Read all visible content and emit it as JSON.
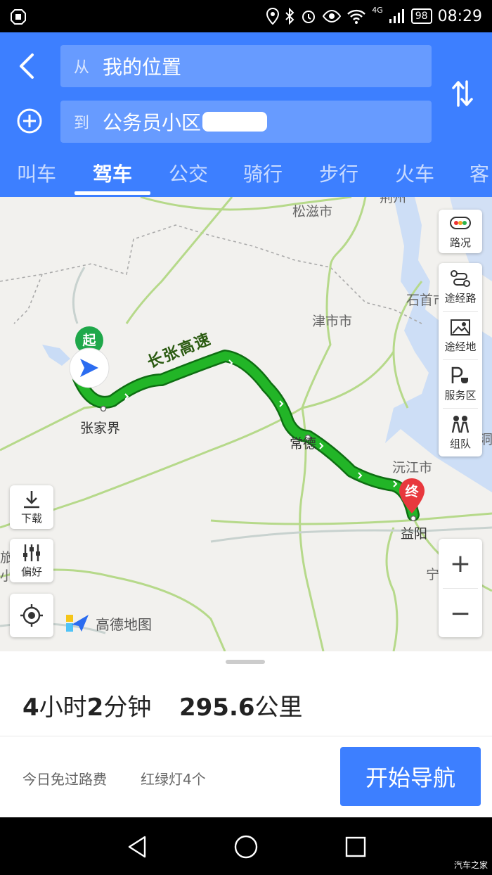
{
  "status_bar": {
    "network": "4G",
    "battery": "98",
    "time": "08:29"
  },
  "route_form": {
    "from_prefix": "从",
    "from_value": "我的位置",
    "to_prefix": "到",
    "to_value": "公务员小区"
  },
  "tabs": [
    {
      "label": "叫车"
    },
    {
      "label": "驾车"
    },
    {
      "label": "公交"
    },
    {
      "label": "骑行"
    },
    {
      "label": "步行"
    },
    {
      "label": "火车"
    },
    {
      "label": "客"
    }
  ],
  "active_tab": "驾车",
  "map": {
    "labels": {
      "songzi": "松滋市",
      "jingzhou": "荆州",
      "shishou": "石首市",
      "jinshi": "津市市",
      "zhangjiajie": "张家界",
      "changde": "常德",
      "yuanjiang": "沅江市",
      "yiyang": "益阳",
      "ning": "宁",
      "dong": "洞",
      "zhangzhang": "长张高速",
      "left_edge_1": "旅",
      "left_edge_2": "小"
    },
    "start_marker": "起",
    "end_marker": "终",
    "route_color": "#22b527",
    "provider": "高德地图"
  },
  "map_controls": {
    "traffic": "路况",
    "via_road": "途经路",
    "via_place": "途经地",
    "service_area": "服务区",
    "team": "组队",
    "download": "下载",
    "preference": "偏好",
    "zoom_in": "+",
    "zoom_out": "−"
  },
  "summary": {
    "hours": "4",
    "hours_unit": "小时",
    "minutes": "2",
    "minutes_unit": "分钟",
    "distance": "295.6",
    "distance_unit": "公里",
    "toll_info": "今日免过路费",
    "traffic_lights": "红绿灯4个",
    "start_nav": "开始导航"
  },
  "watermark": "汽车之家",
  "colors": {
    "brand_blue": "#3d7fff",
    "route_green": "#22b527",
    "end_red": "#e8383d",
    "start_green": "#1fa84a"
  }
}
